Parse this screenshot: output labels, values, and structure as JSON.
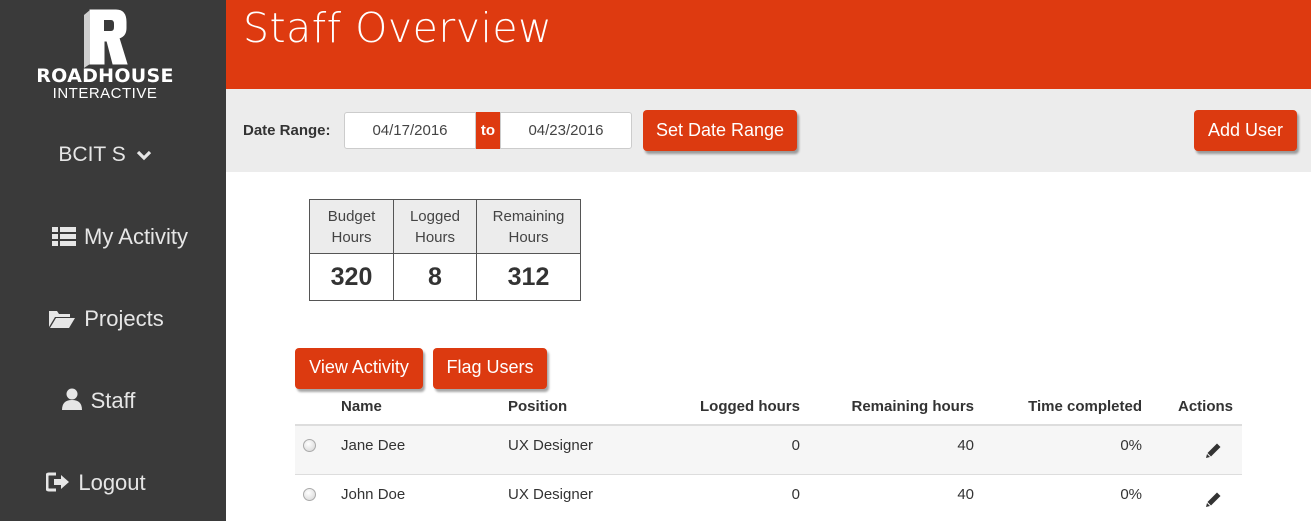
{
  "brand": {
    "line1": "ROADHOUSE",
    "line2": "INTERACTIVE"
  },
  "user_menu": {
    "label": "BCIT S",
    "icon": "chevron-down-icon"
  },
  "nav": {
    "my_activity": {
      "label": "My Activity",
      "icon": "list-icon"
    },
    "projects": {
      "label": "Projects",
      "icon": "folder-open-icon"
    },
    "staff": {
      "label": "Staff",
      "icon": "user-icon"
    },
    "logout": {
      "label": "Logout",
      "icon": "sign-out-icon"
    }
  },
  "header": {
    "title": "Staff Overview"
  },
  "toolbar": {
    "date_range_label": "Date Range:",
    "start_date": "04/17/2016",
    "to_label": "to",
    "end_date": "04/23/2016",
    "set_range_label": "Set Date Range",
    "add_user_label": "Add User"
  },
  "summary": {
    "budget": {
      "label_line1": "Budget",
      "label_line2": "Hours",
      "value": "320"
    },
    "logged": {
      "label_line1": "Logged",
      "label_line2": "Hours",
      "value": "8"
    },
    "remaining": {
      "label_line1": "Remaining",
      "label_line2": "Hours",
      "value": "312"
    }
  },
  "actions": {
    "view_activity_label": "View Activity",
    "flag_users_label": "Flag Users"
  },
  "staff_table": {
    "columns": {
      "name": "Name",
      "position": "Position",
      "logged": "Logged hours",
      "remaining": "Remaining hours",
      "time_completed": "Time completed",
      "actions": "Actions"
    },
    "rows": [
      {
        "name": "Jane Dee",
        "position": "UX Designer",
        "logged": "0",
        "remaining": "40",
        "time_completed": "0%"
      },
      {
        "name": "John Doe",
        "position": "UX Designer",
        "logged": "0",
        "remaining": "40",
        "time_completed": "0%"
      }
    ]
  },
  "colors": {
    "accent": "#de3a10",
    "sidebar": "#3a3a3a",
    "toolbar": "#ececec"
  }
}
